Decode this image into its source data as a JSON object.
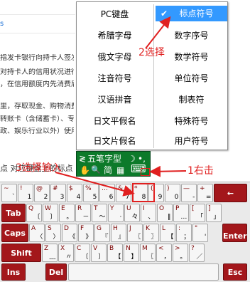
{
  "doc": {
    "lines": [
      "s",
      "指发卡银行向持卡人签发的",
      "对持卡人的信用状况进行",
      "，在信用额度内先消费后还款",
      "里，存取现金、购物消费等功能",
      "转账卡（含储蓄卡）、专用卡和",
      "政、娱乐行业以外）使用的借记"
    ],
    "bottom_text": "点  对应键盘上的标点"
  },
  "menu": {
    "left": [
      "PC键盘",
      "希腊字母",
      "俄文字母",
      "注音符号",
      "汉语拼音",
      "日文平假名",
      "日文片假名"
    ],
    "right": [
      "标点符号",
      "数字序号",
      "数学符号",
      "单位符号",
      "制表符",
      "特殊符号",
      "用户符号"
    ],
    "selected": "标点符号",
    "check_glyph": "✔"
  },
  "ime": {
    "row1": {
      "logo": "≷",
      "name": "五笔字型",
      "moon": "☽",
      "dots": "•,"
    },
    "row2": {
      "hand": "✋",
      "search": "🔍",
      "mode": "简",
      "grid": "▦",
      "keyboard": "⌨"
    }
  },
  "annotations": {
    "step1": "1右击",
    "step2": "2选择",
    "step3": "3选择输入"
  },
  "keyboard": {
    "row1": [
      {
        "t": "~",
        "b": "`"
      },
      {
        "t": "!",
        "b": "1"
      },
      {
        "t": "@",
        "b": "2"
      },
      {
        "t": "#",
        "b": "3"
      },
      {
        "t": "$",
        "b": "4"
      },
      {
        "t": "%",
        "b": "5"
      },
      {
        "t": "…",
        "b": "6"
      },
      {
        "t": "&",
        "b": "7"
      },
      {
        "t": "*",
        "b": "8"
      },
      {
        "t": "(",
        "b": "9"
      },
      {
        "t": ")",
        "b": "0"
      },
      {
        "t": "—",
        "b": "-"
      },
      {
        "t": "+",
        "b": "="
      }
    ],
    "row2": [
      {
        "t": "Q",
        "b": "〔"
      },
      {
        "t": "W",
        "b": "〕"
      },
      {
        "t": "E",
        "b": "。"
      },
      {
        "t": "R",
        "b": "－"
      },
      {
        "t": "T",
        "b": "～"
      },
      {
        "t": "Y",
        "b": "·"
      },
      {
        "t": "U",
        "b": "々"
      },
      {
        "t": "I",
        "b": "、"
      },
      {
        "t": "O",
        "b": "‖"
      },
      {
        "t": "P",
        "b": "…"
      },
      {
        "t": "[",
        "b": "「"
      },
      {
        "t": "]",
        "b": "」"
      }
    ],
    "row3": [
      {
        "t": "A",
        "b": "〈"
      },
      {
        "t": "S",
        "b": "〉"
      },
      {
        "t": "D",
        "b": "《"
      },
      {
        "t": "F",
        "b": "》"
      },
      {
        "t": "G",
        "b": "『"
      },
      {
        "t": "H",
        "b": "』"
      },
      {
        "t": "J",
        "b": "〖"
      },
      {
        "t": "K",
        "b": "〗"
      },
      {
        "t": "L",
        "b": "【"
      },
      {
        "t": ":",
        "b": "；"
      },
      {
        "t": "\"",
        "b": "'"
      }
    ],
    "row4": [
      {
        "t": "Z",
        "b": "﹏"
      },
      {
        "t": "X",
        "b": "〃"
      },
      {
        "t": "C",
        "b": "〔"
      },
      {
        "t": "V",
        "b": "〕"
      },
      {
        "t": "B",
        "b": "【"
      },
      {
        "t": "N",
        "b": "】"
      },
      {
        "t": "M",
        "b": "〖"
      },
      {
        "t": "<",
        "b": "，"
      },
      {
        "t": ">",
        "b": "。"
      },
      {
        "t": "?",
        "b": "／"
      }
    ],
    "fn": {
      "tab": "Tab",
      "caps": "Caps",
      "shift": "Shift",
      "enter": "Enter",
      "back": "←",
      "ins": "Ins",
      "del": "Del",
      "esc": "Esc"
    }
  }
}
